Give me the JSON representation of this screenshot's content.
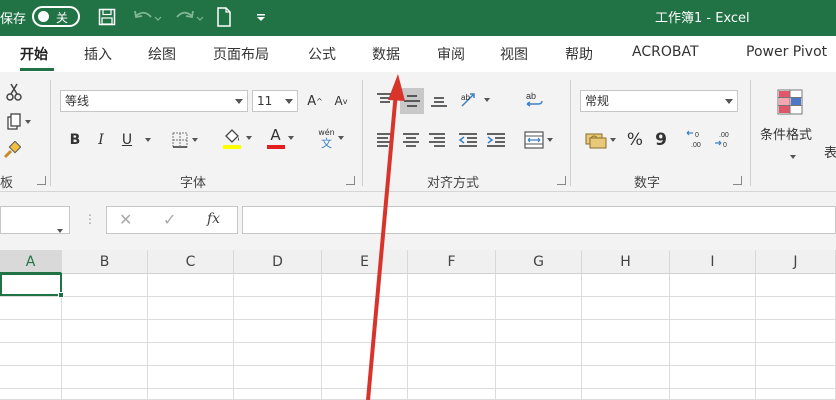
{
  "titlebar": {
    "autosave_label": "保存",
    "toggle_label": "关",
    "doc_title": "工作簿1 - Excel"
  },
  "tabs": [
    {
      "label": "开始",
      "active": true
    },
    {
      "label": "插入"
    },
    {
      "label": "绘图"
    },
    {
      "label": "页面布局"
    },
    {
      "label": "公式"
    },
    {
      "label": "数据"
    },
    {
      "label": "审阅"
    },
    {
      "label": "视图"
    },
    {
      "label": "帮助"
    },
    {
      "label": "ACROBAT"
    },
    {
      "label": "Power Pivot"
    }
  ],
  "ribbon": {
    "clipboard_label_fragment": "板",
    "font": {
      "name": "等线",
      "size": "11",
      "group_label": "字体",
      "bold": "B",
      "italic": "I",
      "underline": "U",
      "font_color_letter": "A",
      "grow": "A",
      "shrink": "A",
      "wen_top": "wén",
      "wen_bottom": "文"
    },
    "alignment": {
      "group_label": "对齐方式"
    },
    "number": {
      "format": "常规",
      "group_label": "数字",
      "percent": "%",
      "comma": "9"
    },
    "styles": {
      "conditional_format": "条件格式",
      "next_fragment": "表"
    }
  },
  "formula_bar": {
    "fx": "fx",
    "value": ""
  },
  "columns": [
    "A",
    "B",
    "C",
    "D",
    "E",
    "F",
    "G",
    "H",
    "I",
    "J"
  ],
  "colors": {
    "brand": "#217346",
    "arrow": "#d9342b",
    "font_color_bar": "#e21e1e",
    "fill_color_bar": "#ffff00"
  }
}
